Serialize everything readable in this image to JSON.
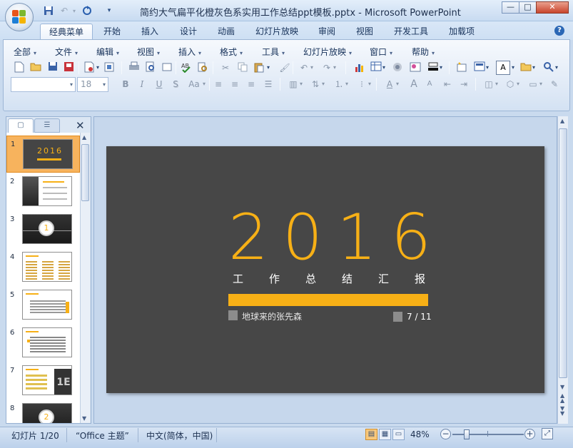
{
  "window": {
    "title": "简约大气扁平化橙灰色系实用工作总结ppt模板.pptx - Microsoft PowerPoint",
    "controls": {
      "minimize": "—",
      "maximize": "□",
      "close": "✕"
    }
  },
  "qat": {
    "save_icon": "floppy-icon",
    "undo_icon": "undo-icon",
    "redo_icon": "redo-icon",
    "more": "▾"
  },
  "tabs": [
    "经典菜单",
    "开始",
    "插入",
    "设计",
    "动画",
    "幻灯片放映",
    "审阅",
    "视图",
    "开发工具",
    "加载项"
  ],
  "active_tab": 0,
  "help_icon": "?",
  "menus": [
    "全部",
    "文件",
    "编辑",
    "视图",
    "插入",
    "格式",
    "工具",
    "幻灯片放映",
    "窗口",
    "帮助"
  ],
  "font": {
    "name": "",
    "size": "18"
  },
  "format_buttons": {
    "bold": "B",
    "italic": "I",
    "underline": "U",
    "shadow": "S",
    "case": "Aa"
  },
  "font_color_label": "A",
  "grow_font": "A",
  "shrink_font": "A",
  "pane": {
    "close": "✕",
    "tab_slides": "▢",
    "tab_outline": "☰"
  },
  "slides": [
    {
      "num": "1",
      "selected": true
    },
    {
      "num": "2",
      "selected": false
    },
    {
      "num": "3",
      "selected": false,
      "badge": "1"
    },
    {
      "num": "4",
      "selected": false
    },
    {
      "num": "5",
      "selected": false
    },
    {
      "num": "6",
      "selected": false
    },
    {
      "num": "7",
      "selected": false
    },
    {
      "num": "8",
      "selected": false,
      "badge": "2"
    }
  ],
  "thumb1_text": "2016",
  "thumb7_text": "1E",
  "slide": {
    "year": "2016",
    "subtitle": "工作总结汇报",
    "author": "地球来的张先森",
    "page": "7 / 11",
    "accent_color": "#f7b016",
    "background_color": "#474747"
  },
  "statusbar": {
    "slide_info": "幻灯片 1/20",
    "theme": "“Office 主题”",
    "language": "中文(简体，中国)",
    "zoom": "48%",
    "zoom_minus": "−",
    "zoom_plus": "+",
    "zoom_fraction": 0.2
  }
}
